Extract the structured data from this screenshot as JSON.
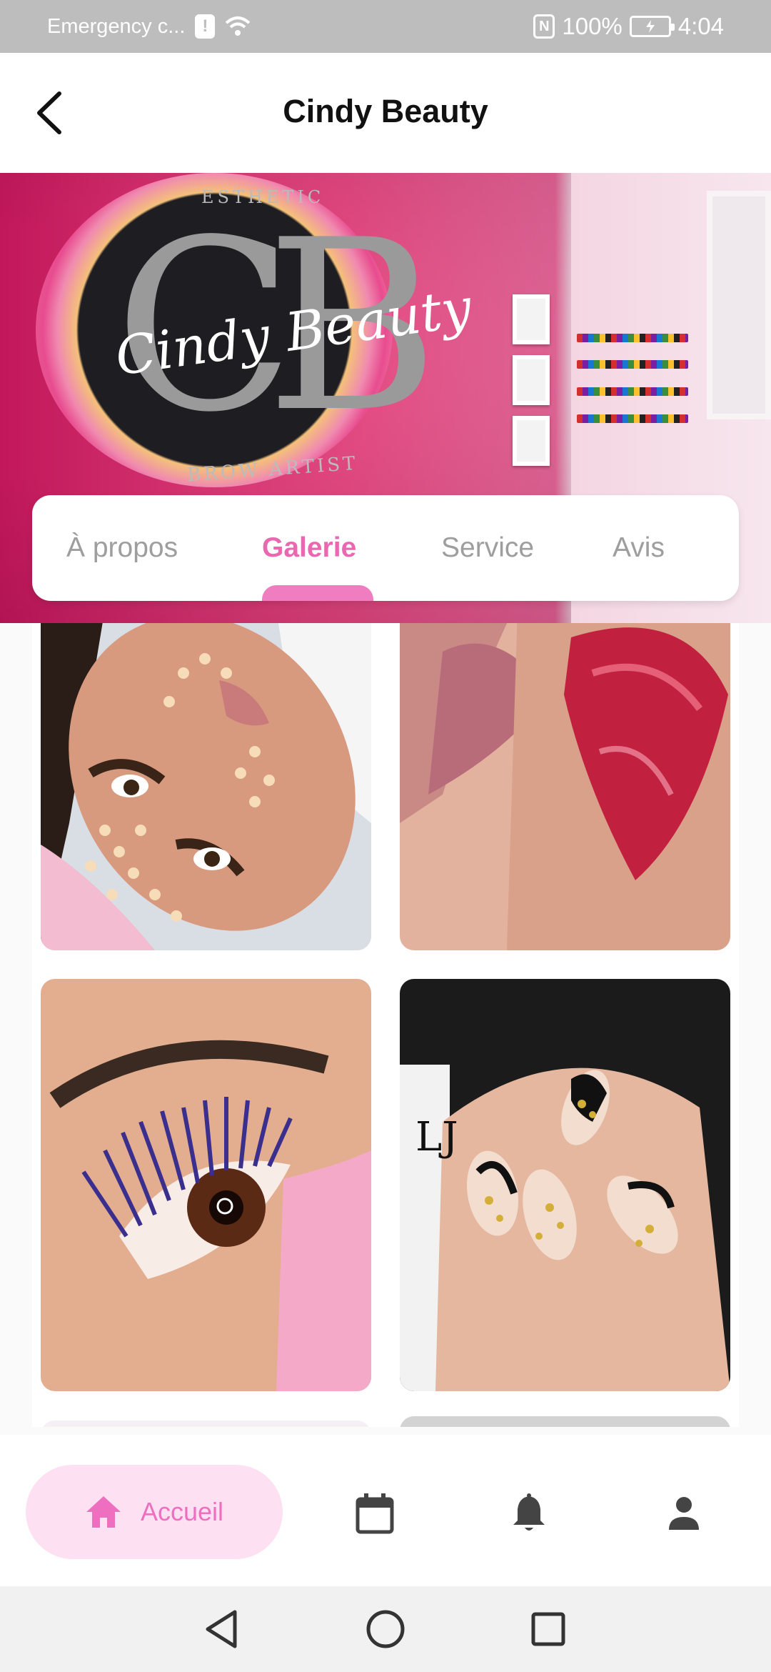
{
  "status_bar": {
    "carrier": "Emergency c...",
    "battery": "100%",
    "time": "4:04"
  },
  "header": {
    "title": "Cindy Beauty"
  },
  "hero": {
    "logo_letters": "CB",
    "logo_script": "Cindy Beauty",
    "logo_top": "ESTHETIC",
    "logo_bottom": "BROW ARTIST"
  },
  "tabs": [
    {
      "label": "À propos",
      "active": false
    },
    {
      "label": "Galerie",
      "active": true
    },
    {
      "label": "Service",
      "active": false
    },
    {
      "label": "Avis",
      "active": false
    }
  ],
  "gallery": {
    "items": [
      {
        "subject": "facial-makeup"
      },
      {
        "subject": "lips-before-after"
      },
      {
        "subject": "eyelash-extensions"
      },
      {
        "subject": "nail-art"
      }
    ],
    "nail_watermark": "LJ"
  },
  "bottom_nav": {
    "home_label": "Accueil",
    "items": [
      "home-icon",
      "calendar-icon",
      "bell-icon",
      "person-icon"
    ]
  },
  "colors": {
    "accent_pink": "#e968b0",
    "nav_active_bg": "#fde0f1",
    "status_bar_bg": "#bdbdbd"
  }
}
